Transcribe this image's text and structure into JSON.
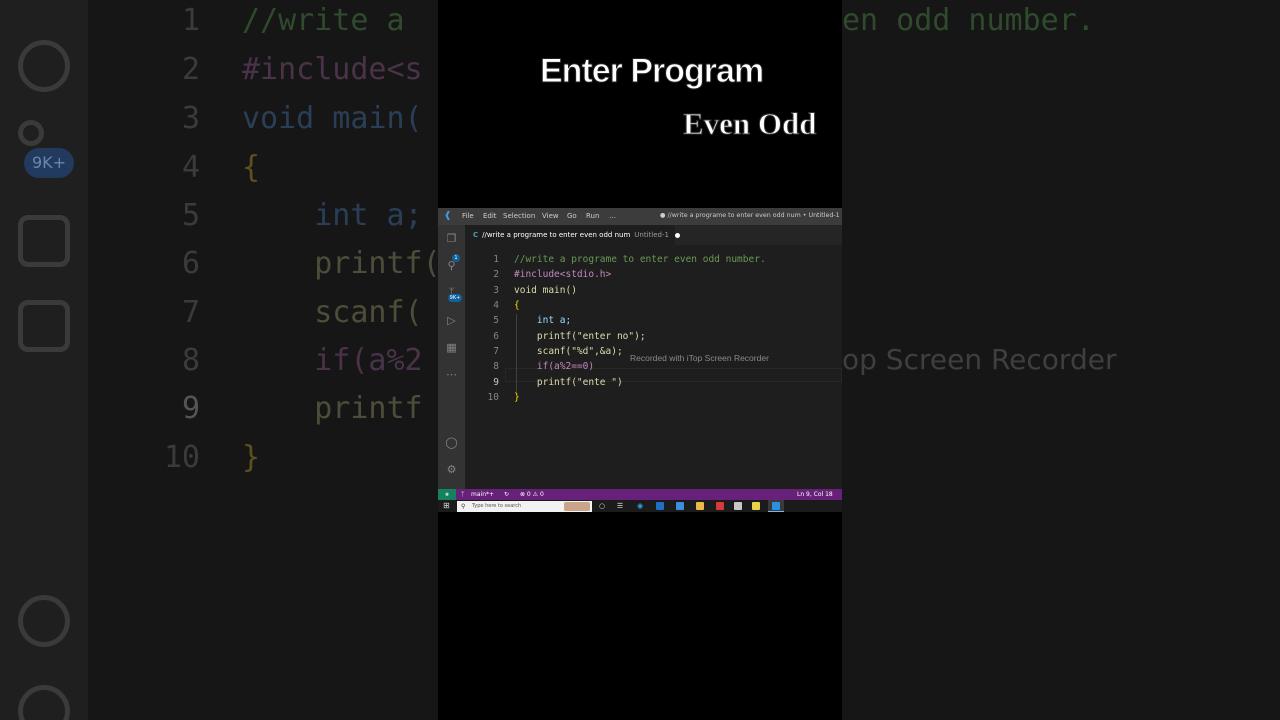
{
  "overlay": {
    "title_line1": "Enter Program",
    "title_line2": "Even Odd"
  },
  "window": {
    "menu": [
      "File",
      "Edit",
      "Selection",
      "View",
      "Go",
      "Run",
      "…"
    ],
    "title": "● //write a programe to enter even odd num • Untitled-1 • Vi"
  },
  "activity_bar": {
    "explorer_badge": "1",
    "scm_badge": "9K+"
  },
  "tab": {
    "icon": "C",
    "label": "//write a programe to enter even odd num",
    "sublabel": "Untitled-1"
  },
  "editor": {
    "line_numbers": [
      "1",
      "2",
      "3",
      "4",
      "5",
      "6",
      "7",
      "8",
      "9",
      "10"
    ],
    "active_line": 9,
    "lines": [
      "//write a programe to enter even odd number.",
      "#include<stdio.h>",
      "void main()",
      "{",
      "    int a;",
      "    printf(\"enter no\");",
      "    scanf(\"%d\",&a);",
      "    if(a%2==0)",
      "    printf(\"ente \")",
      "}"
    ],
    "watermark_hint": "Recorded with iTop Screen Recorder"
  },
  "status_bar": {
    "remote_icon": "⨳",
    "branch": "main*+",
    "sync_icon": "↻",
    "errors": "⊗ 0 ⚠ 0",
    "position": "Ln 9, Col 18"
  },
  "taskbar": {
    "search_placeholder": "Type here to search"
  },
  "background": {
    "line_numbers": [
      "1",
      "2",
      "3",
      "4",
      "5",
      "6",
      "7",
      "8",
      "9",
      "10"
    ],
    "lines": [
      "//write a",
      "#include<s",
      "void main(",
      "{",
      "    int a;",
      "    printf(",
      "    scanf(",
      "    if(a%2",
      "    printf",
      "}"
    ],
    "right_fragment": "en odd number.",
    "watermark": "op Screen Recorder",
    "badge": "9K+"
  },
  "colors": {
    "status_bar": "#68217a",
    "remote": "#16825d",
    "editor_bg": "#1e1e1e",
    "accent": "#0e639c"
  }
}
